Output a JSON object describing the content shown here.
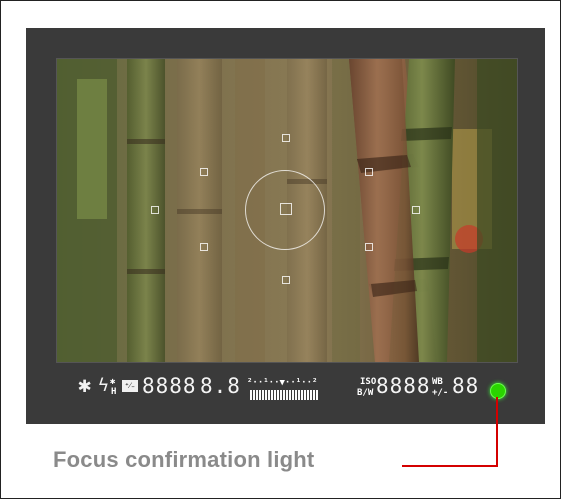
{
  "viewfinder": {
    "scene_description_icon": "bamboo-photo",
    "info": {
      "ae_lock": "✱",
      "flash": "ϟ",
      "fe_lock": "✱",
      "high_speed_sync": "H",
      "flash_comp": "⁺⁄₋",
      "shutter_digits": "8888",
      "aperture_digits": "8.8",
      "exposure_scale": "²··¹··▼··¹··²",
      "iso_label": "ISO",
      "bw_label": "B/W",
      "iso_digits": "8888",
      "wb_label": "WB",
      "wb_plus_minus": "+/-",
      "shots_digits": "88"
    },
    "focus_led_color": "#2ad400"
  },
  "caption": {
    "text": "Focus confirmation light"
  },
  "colors": {
    "leader": "#d40000",
    "caption": "#8a8a8a",
    "viewfinder_bg": "#3a3a3a"
  }
}
